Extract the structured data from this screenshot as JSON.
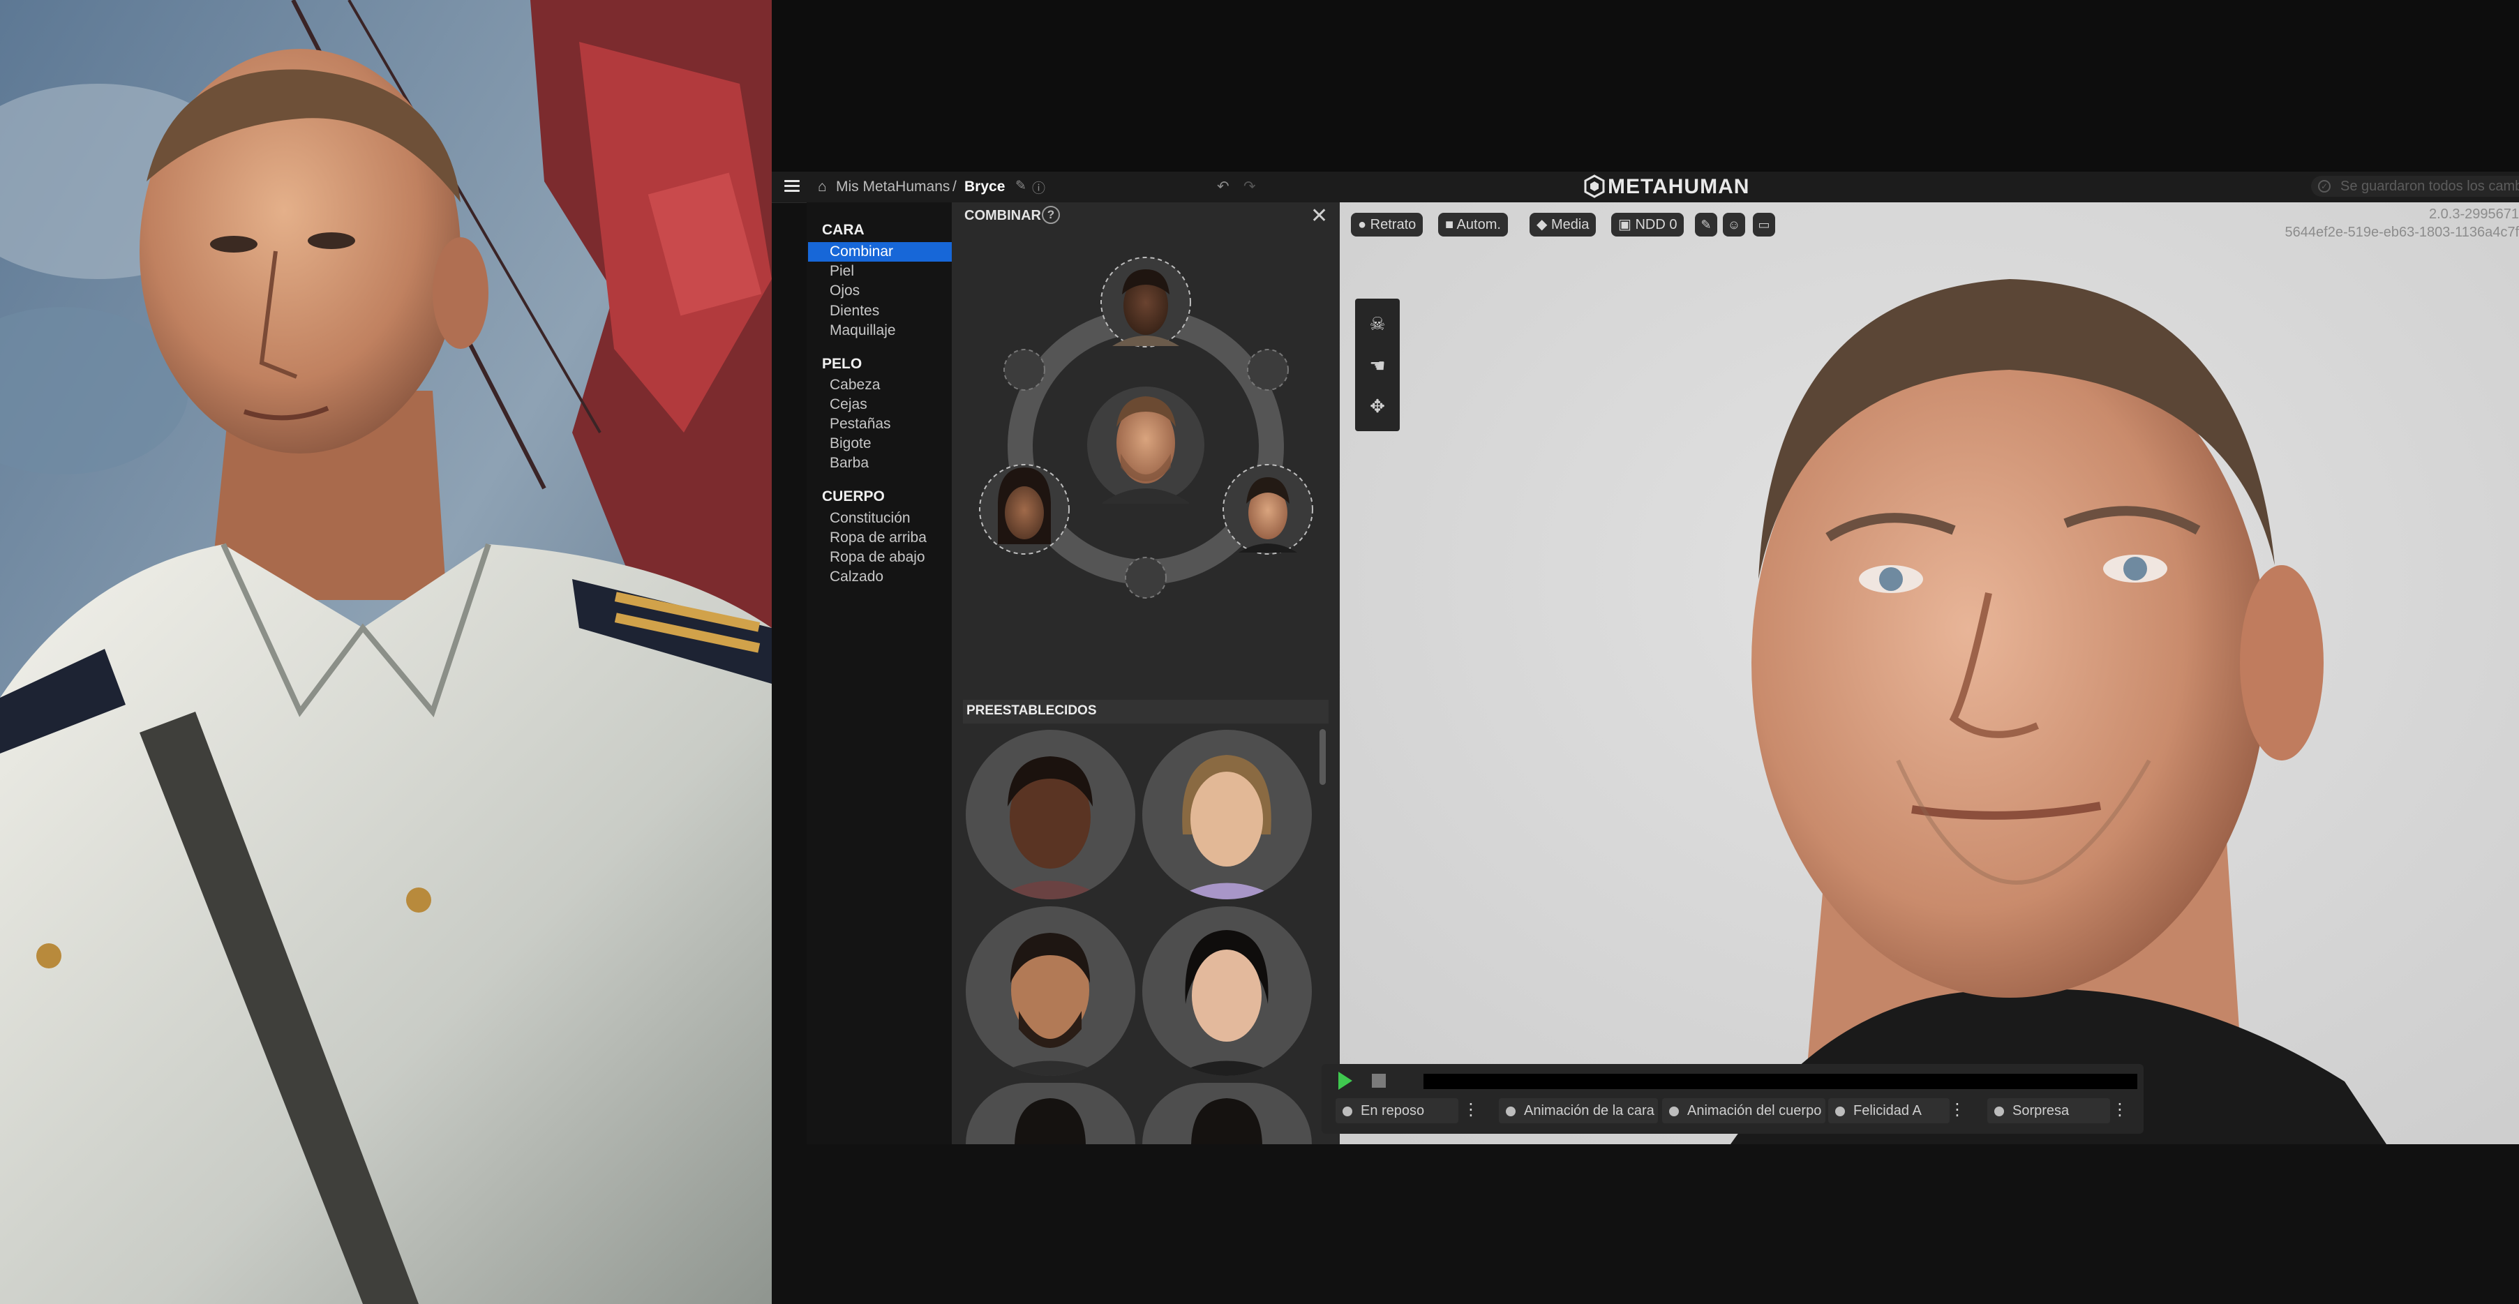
{
  "titlebar": {
    "breadcrumb_link": "Mis MetaHumans",
    "breadcrumb_separator": "/",
    "breadcrumb_current": "Bryce",
    "logo_text": "METAHUMAN",
    "save_status": "Se guardaron todos los cambios"
  },
  "sidebar": {
    "sections": [
      {
        "title": "CARA",
        "items": [
          "Combinar",
          "Piel",
          "Ojos",
          "Dientes",
          "Maquillaje"
        ]
      },
      {
        "title": "PELO",
        "items": [
          "Cabeza",
          "Cejas",
          "Pestañas",
          "Bigote",
          "Barba"
        ]
      },
      {
        "title": "CUERPO",
        "items": [
          "Constitución",
          "Ropa de arriba",
          "Ropa de abajo",
          "Calzado"
        ]
      }
    ],
    "active_item": "Combinar"
  },
  "panel": {
    "title": "COMBINAR",
    "help": "?",
    "close": "✕",
    "presets_title": "PREESTABLECIDOS"
  },
  "viewport": {
    "buttons": [
      "Retrato",
      "Autom.",
      "Media",
      "NDD 0"
    ],
    "version": "2.0.3-2995671",
    "guid": "5644ef2e-519e-eb63-1803-1136a4c7f"
  },
  "playback": {
    "chips": [
      "En reposo",
      "Animación de la cara",
      "Animación del cuerpo",
      "Felicidad A",
      "Sorpresa"
    ]
  },
  "colors": {
    "accent": "#1767d8",
    "play": "#3fc84f",
    "background": "#111111"
  }
}
